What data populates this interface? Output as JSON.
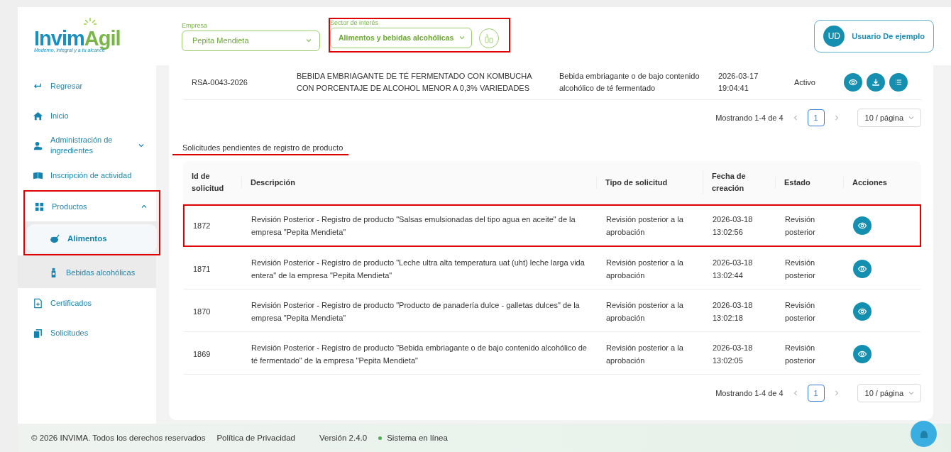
{
  "header": {
    "logo": {
      "wordmark": [
        "Invim",
        "Agil"
      ],
      "tagline": "Moderno, integral y a tu alcance"
    },
    "company_field": {
      "label": "Empresa",
      "value": "Pepita Mendieta"
    },
    "sector_field": {
      "label": "Sector de interés",
      "value": "Alimentos y bebidas alcohólicas",
      "annotated": true
    },
    "user": {
      "initials": "UD",
      "name": "Usuario De ejemplo"
    }
  },
  "sidebar": {
    "items": [
      {
        "kind": "back",
        "label": "Regresar",
        "selected": false
      },
      {
        "kind": "home",
        "label": "Inicio",
        "selected": false
      },
      {
        "kind": "ingredients",
        "label": "Administración de ingredientes",
        "selected": false,
        "expanded": false
      },
      {
        "kind": "activity",
        "label": "Inscripción de actividad",
        "selected": false
      },
      {
        "kind": "products",
        "label": "Productos",
        "selected": false,
        "expanded": true,
        "annotated": true,
        "children": [
          {
            "kind": "food",
            "label": "Alimentos",
            "selected": true,
            "annotated": true
          },
          {
            "kind": "drink",
            "label": "Bebidas alcohólicas",
            "selected": false,
            "annotated": false
          }
        ]
      },
      {
        "kind": "certificates",
        "label": "Certificados",
        "selected": false
      },
      {
        "kind": "requests",
        "label": "Solicitudes",
        "selected": false
      }
    ]
  },
  "registered_products": {
    "rows": [
      {
        "id": "RSA-0043-2026",
        "description": "BEBIDA EMBRIAGANTE DE TÉ FERMENTADO CON KOMBUCHA CON PORCENTAJE DE ALCOHOL MENOR A 0,3% VARIEDADES",
        "category": "Bebida embriagante o de bajo contenido alcohólico de té fermentado",
        "date": "2026-03-17 19:04:41",
        "status": "Activo"
      }
    ],
    "pager": {
      "summary": "Mostrando 1-4 de 4",
      "pages": [
        {
          "label": "1",
          "selected": true
        }
      ],
      "page_size": "10 / página"
    }
  },
  "pending_requests": {
    "title": "Solicitudes pendientes de registro de producto",
    "underlined": true,
    "columns": [
      "Id de solicitud",
      "Descripción",
      "Tipo de solicitud",
      "Fecha de creación",
      "Estado",
      "Acciones"
    ],
    "rows": [
      {
        "id": "1872",
        "description": "Revisión Posterior - Registro de producto \"Salsas emulsionadas del tipo agua en aceite\" de la empresa \"Pepita Mendieta\"",
        "type": "Revisión posterior a la aprobación",
        "created": "2026-03-18 13:02:56",
        "status": "Revisión posterior",
        "annotated": true
      },
      {
        "id": "1871",
        "description": "Revisión Posterior - Registro de producto \"Leche ultra alta temperatura uat (uht) leche larga vida entera\" de la empresa \"Pepita Mendieta\"",
        "type": "Revisión posterior a la aprobación",
        "created": "2026-03-18 13:02:44",
        "status": "Revisión posterior",
        "annotated": false
      },
      {
        "id": "1870",
        "description": "Revisión Posterior - Registro de producto \"Producto de panadería dulce - galletas dulces\" de la empresa \"Pepita Mendieta\"",
        "type": "Revisión posterior a la aprobación",
        "created": "2026-03-18 13:02:18",
        "status": "Revisión posterior",
        "annotated": false
      },
      {
        "id": "1869",
        "description": "Revisión Posterior - Registro de producto \"Bebida embriagante o de bajo contenido alcohólico de té fermentado\" de la empresa \"Pepita Mendieta\"",
        "type": "Revisión posterior a la aprobación",
        "created": "2026-03-18 13:02:05",
        "status": "Revisión posterior",
        "annotated": false
      }
    ],
    "pager": {
      "summary": "Mostrando 1-4 de 4",
      "pages": [
        {
          "label": "1",
          "selected": true
        }
      ],
      "page_size": "10 / página"
    }
  },
  "footer": {
    "copyright": "© 2026 INVIMA. Todos los derechos reservados",
    "privacy": "Política de Privacidad",
    "version": "Versión 2.4.0",
    "status": "Sistema en línea",
    "online": true
  }
}
